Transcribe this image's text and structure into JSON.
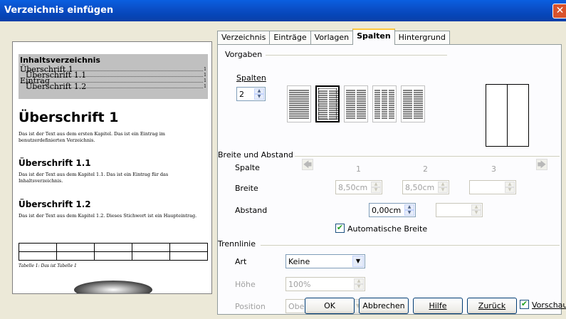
{
  "window": {
    "title": "Verzeichnis einfügen",
    "close_glyph": "✕"
  },
  "preview": {
    "toc_title": "Inhaltsverzeichnis",
    "toc_entries": [
      {
        "label": "Überschrift 1",
        "page": "1"
      },
      {
        "label": "Überschrift 1.1",
        "page": "1"
      },
      {
        "label": "Eintrag",
        "page": "1"
      },
      {
        "label": "Überschrift 1.2",
        "page": "1"
      }
    ],
    "heading1": "Überschrift 1",
    "para1": "Das ist der Text aus dem ersten Kapitel. Das ist ein Eintrag im benutzerdefinierten Verzeichnis.",
    "heading11": "Überschrift 1.1",
    "para2": "Das ist der Text aus dem Kapitel 1.1. Das ist ein Eintrag für das Inhaltsverzeichnis.",
    "heading12": "Überschrift 1.2",
    "para3": "Das ist der Text aus dem Kapitel 1.2. Dieses Stichwort ist ein Haupteintrag.",
    "caption": "Tabelle 1: Das ist Tabelle 1"
  },
  "tabs": [
    {
      "label": "Verzeichnis",
      "active": false
    },
    {
      "label": "Einträge",
      "active": false
    },
    {
      "label": "Vorlagen",
      "active": false
    },
    {
      "label": "Spalten",
      "active": true
    },
    {
      "label": "Hintergrund",
      "active": false
    }
  ],
  "presets": {
    "group_label": "Vorgaben",
    "columns_label": "Spalten",
    "columns_value": "2",
    "selected_preset": 2,
    "preset_columns": [
      1,
      2,
      3,
      4,
      5
    ]
  },
  "width_spacing": {
    "group_label": "Breite und Abstand",
    "column_label": "Spalte",
    "column_numbers": [
      "1",
      "2",
      "3"
    ],
    "width_label": "Breite",
    "widths": [
      "8,50cm",
      "8,50cm",
      ""
    ],
    "spacing_label": "Abstand",
    "spacings": [
      "0,00cm",
      ""
    ],
    "auto_width_label": "Automatische Breite",
    "auto_width_checked": true,
    "prev_glyph": "🡄",
    "next_glyph": "🡆"
  },
  "separator": {
    "group_label": "Trennlinie",
    "type_label": "Art",
    "type_value": "Keine",
    "height_label": "Höhe",
    "height_value": "100%",
    "position_label": "Position",
    "position_value": "Oben"
  },
  "buttons": {
    "ok": "OK",
    "cancel": "Abbrechen",
    "help": "Hilfe",
    "back": "Zurück",
    "preview_label": "Vorschau",
    "preview_checked": true
  }
}
